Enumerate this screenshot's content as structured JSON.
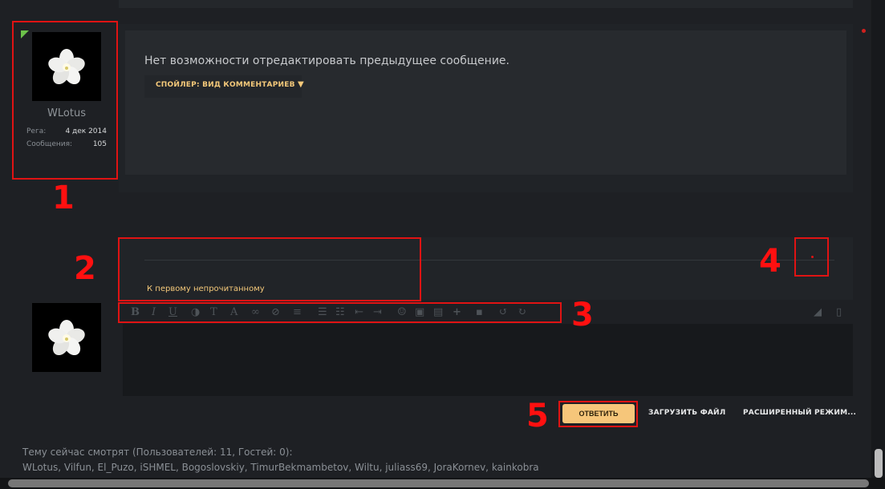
{
  "post": {
    "text": "Нет возможности отредактировать предыдущее сообщение.",
    "spoiler_label": "СПОЙЛЕР: ВИД КОММЕНТАРИЕВ",
    "spoiler_arrow": "▼"
  },
  "author": {
    "username": "WLotus",
    "reg_label": "Рега:",
    "reg_value": "4 дек 2014",
    "posts_label": "Сообщения:",
    "posts_value": "105"
  },
  "reply": {
    "unread_link": "К первому непрочитанному",
    "submit_label": "ОТВЕТИТЬ",
    "upload_label": "ЗАГРУЗИТЬ ФАЙЛ",
    "advanced_label": "РАСШИРЕННЫЙ РЕЖИМ..."
  },
  "toolbar": {
    "icons": [
      "bold-icon",
      "italic-icon",
      "underline-icon",
      "color-icon",
      "text-size-icon",
      "font-icon",
      "link-icon",
      "unlink-icon",
      "align-icon",
      "bullet-list-icon",
      "numbered-list-icon",
      "outdent-icon",
      "indent-icon",
      "smiley-icon",
      "image-icon",
      "media-icon",
      "insert-icon",
      "save-icon",
      "undo-icon",
      "redo-icon",
      "eraser-icon",
      "source-icon"
    ]
  },
  "annotations": {
    "n1": "1",
    "n2": "2",
    "n3": "3",
    "n4": "4",
    "n5": "5"
  },
  "viewers": {
    "title": "Тему сейчас смотрят (Пользователей: 11, Гостей: 0):",
    "list": "WLotus, Vilfun, El_Puzo, iSHMEL, Bogoslovskiy, TimurBekmambetov, Wiltu, juliass69, JoraKornev, kainkobra"
  },
  "colors": {
    "accent": "#f6c67a",
    "annotation": "#e01313",
    "online": "#6cc14a"
  }
}
